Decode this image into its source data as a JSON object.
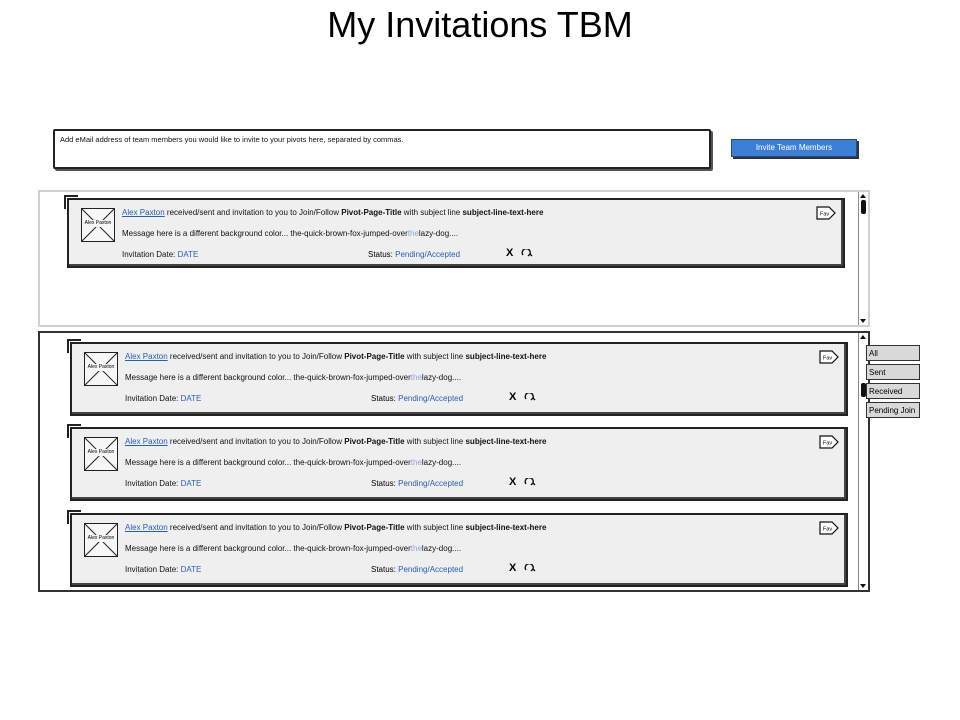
{
  "page": {
    "title": "My Invitations TBM"
  },
  "invite": {
    "placeholder": "Add eMail address of team members you would like to invite to your pivots here, separated by commas.",
    "button_label": "Invite Team Members"
  },
  "filters": [
    "All",
    "Sent",
    "Received",
    "Pending Join"
  ],
  "card_text": {
    "sender": "Alex Paxton",
    "action": " received/sent and invitation to you to Join/Follow ",
    "pivot": "Pivot-Page-Title",
    "with_subject": " with subject line ",
    "subject": "subject-line-text-here",
    "message_prefix": "Message here is a different background color...  the-quick-brown-fox-jumped-over",
    "message_the": "the",
    "message_suffix": "lazy-dog....",
    "date_label": "Invitation Date: ",
    "date_value": "DATE",
    "status_label": "Status: ",
    "status_value": "Pending/Accepted",
    "decline": "X",
    "fav": "Fav",
    "avatar_label": "Alex Paxton"
  },
  "colors": {
    "accent": "#3d7fd6",
    "link": "#2a5db0",
    "card_bg": "#efefef"
  }
}
